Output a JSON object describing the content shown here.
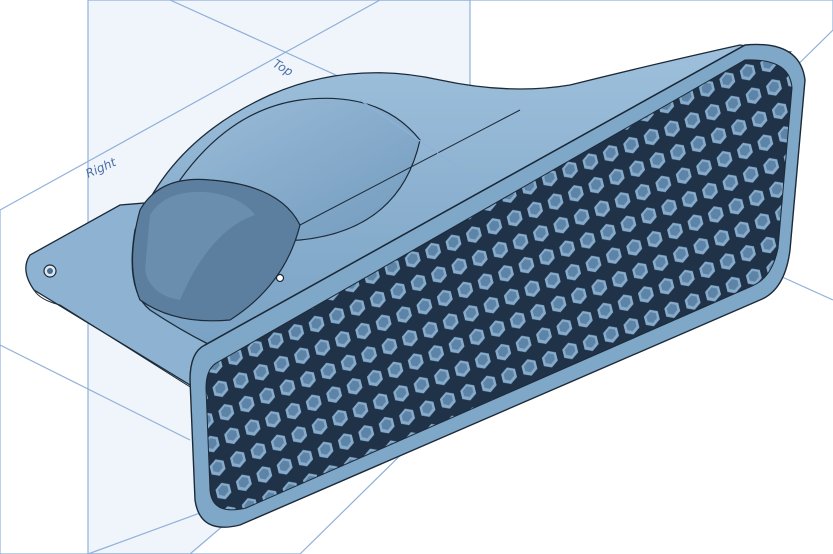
{
  "planes": {
    "right_label": "Right",
    "top_label": "Top"
  },
  "colors": {
    "part_fill": "#7fa7c8",
    "part_light": "#a9c7e0",
    "part_dark": "#5b82a6",
    "edge": "#1c2a38",
    "plane_line": "#8fb0da",
    "plane_fill": "#e3ecf7"
  },
  "model": {
    "description_icon": "3d-part-icon"
  }
}
